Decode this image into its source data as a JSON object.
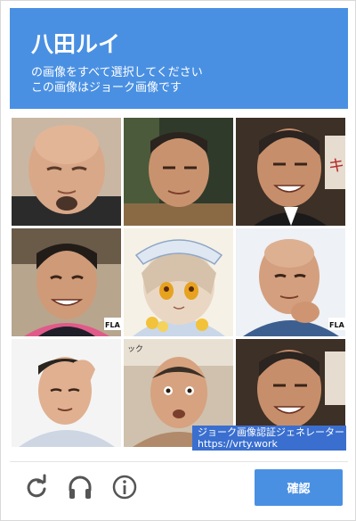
{
  "header": {
    "title": "八田ルイ",
    "instruction_line1": "の画像をすべて選択してください",
    "instruction_line2": "この画像はジョーク画像です"
  },
  "grid": {
    "tiles": [
      {
        "subject": "bald man with goatee, eyes closed"
      },
      {
        "subject": "man with short hair, dark background"
      },
      {
        "subject": "smiling man in suit"
      },
      {
        "subject": "smiling man with dark hair"
      },
      {
        "subject": "anime girl with hat and flowers"
      },
      {
        "subject": "bald man, hand on chin"
      },
      {
        "subject": "man with hand on head"
      },
      {
        "subject": "man with combover, surprised"
      },
      {
        "subject": "smiling man in suit"
      }
    ]
  },
  "tile_labels": {
    "flag_a": "FLA",
    "flag_b": "FLA",
    "sign_text": "ック"
  },
  "watermark": {
    "line1": "ジョーク画像認証ジェネレーター",
    "line2": "https://vrty.work"
  },
  "footer": {
    "refresh_icon": "refresh-icon",
    "audio_icon": "headphones-icon",
    "info_icon": "info-icon",
    "verify_label": "確認"
  },
  "colors": {
    "accent": "#4a90e2",
    "watermark_bg": "#3a6fcf",
    "icon_gray": "#555555"
  }
}
